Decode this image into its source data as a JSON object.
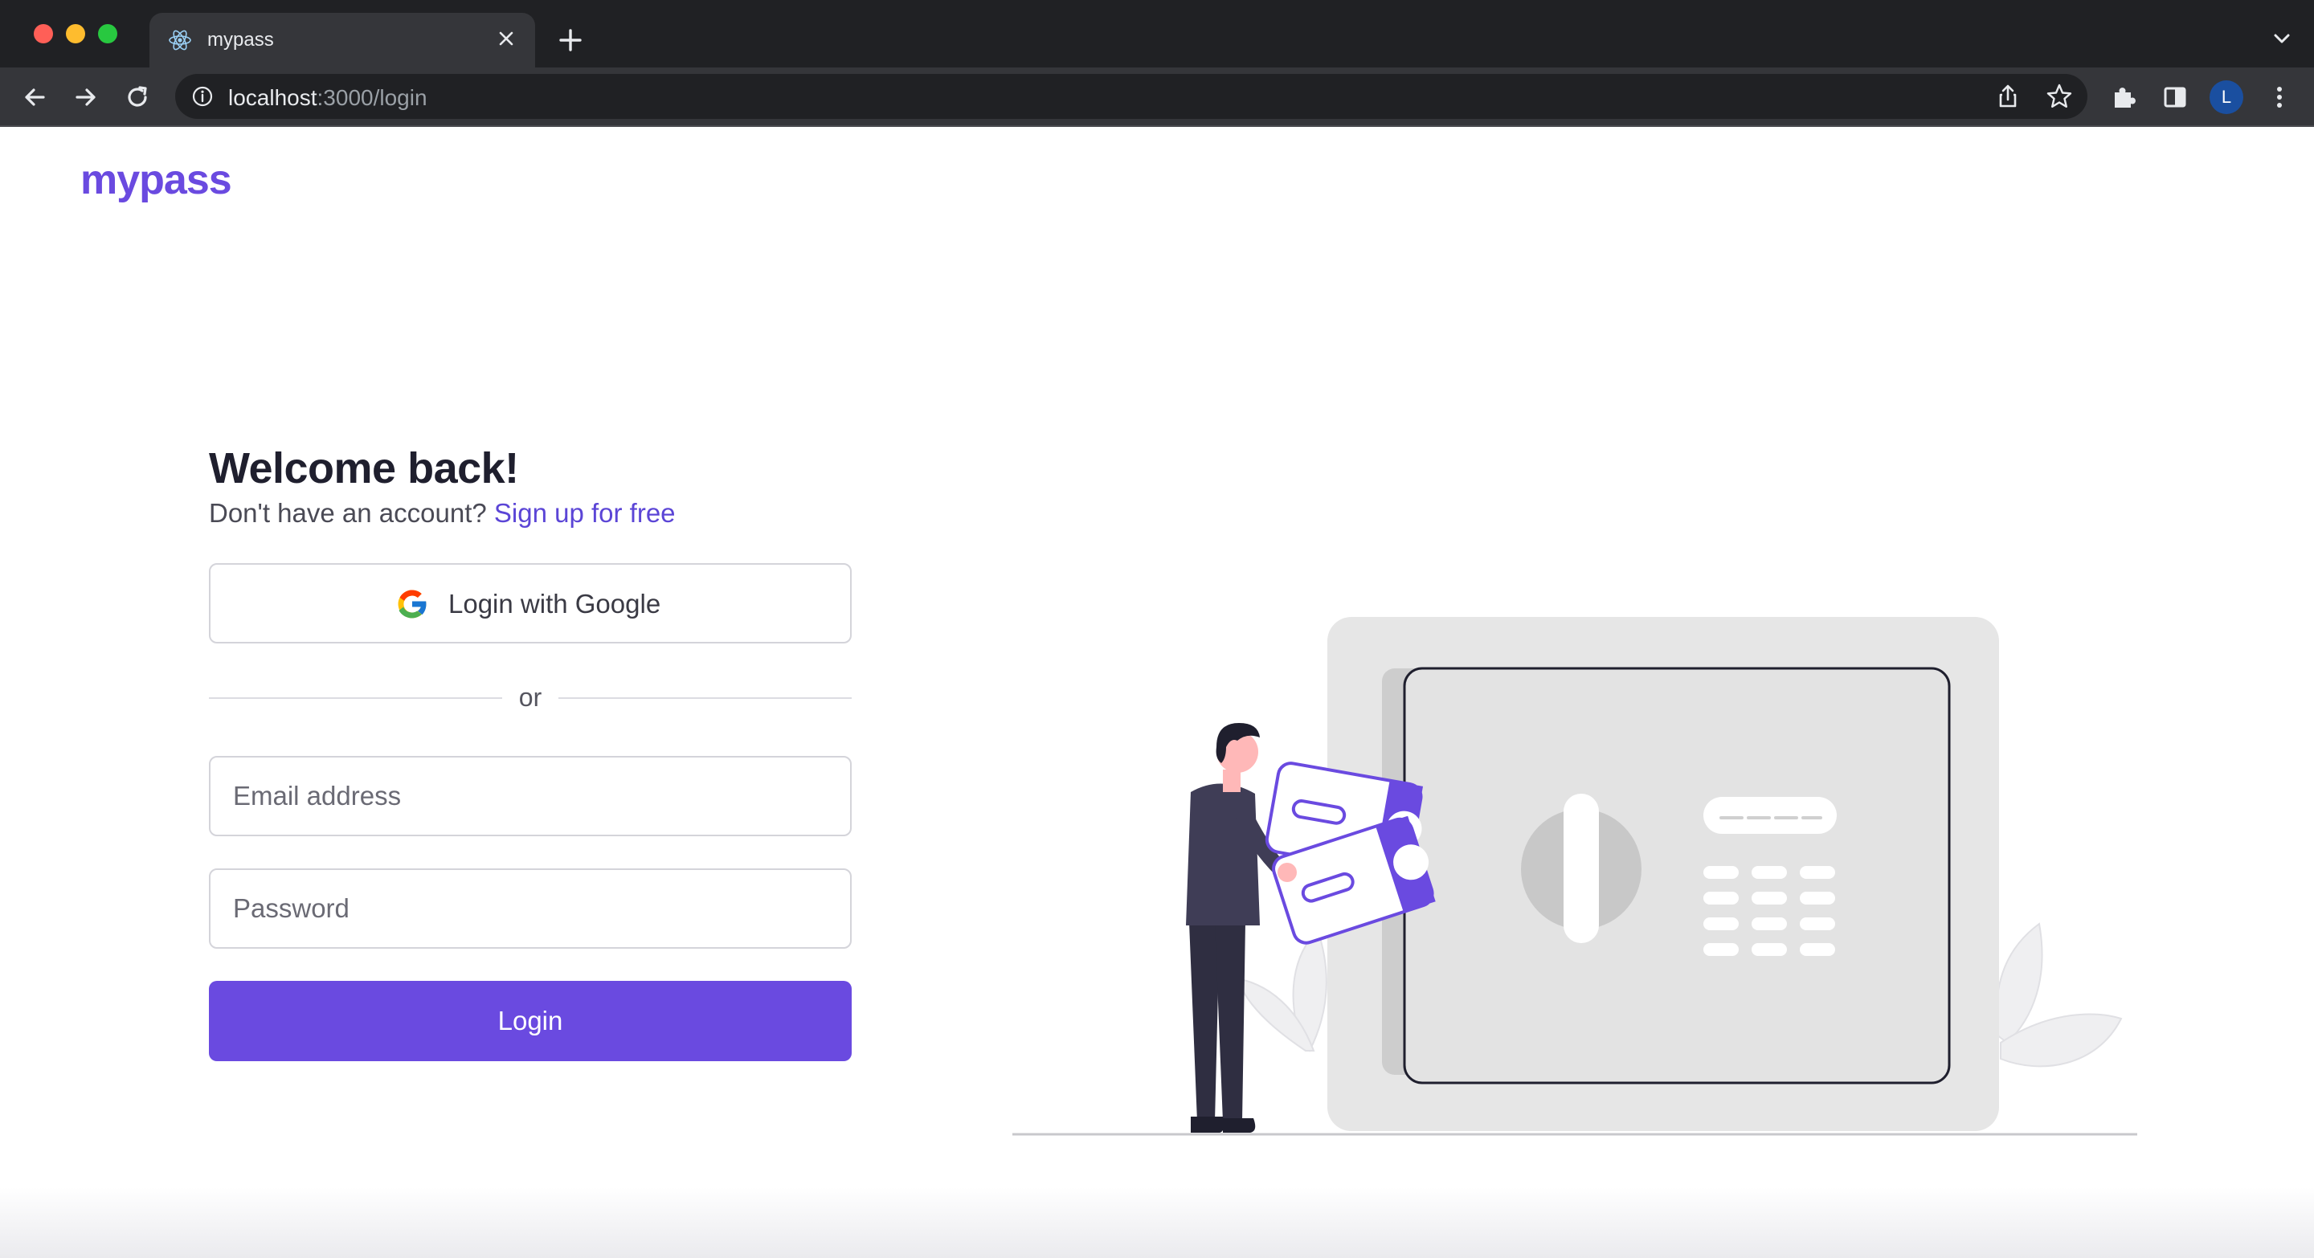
{
  "browser": {
    "tab_title": "mypass",
    "url_host": "localhost",
    "url_path": ":3000/login",
    "profile_initial": "L",
    "icons": [
      "react-favicon-icon",
      "close-icon",
      "plus-icon",
      "chevron-down-icon",
      "back-arrow-icon",
      "forward-arrow-icon",
      "reload-icon",
      "info-icon",
      "share-icon",
      "star-icon",
      "puzzle-icon",
      "sidebar-icon",
      "kebab-menu-icon"
    ]
  },
  "page": {
    "logo": "mypass",
    "heading": "Welcome back!",
    "subtext": "Don't have an account?",
    "signup_link": "Sign up for free",
    "google_button": "Login with Google",
    "divider_text": "or",
    "email_placeholder": "Email address",
    "password_placeholder": "Password",
    "login_button": "Login",
    "illustration_icon": "person-with-safe-illustration"
  },
  "colors": {
    "brand": "#6a4ae0",
    "link": "#5b45d6",
    "chrome_dark": "#202124",
    "chrome_toolbar": "#35363a"
  }
}
